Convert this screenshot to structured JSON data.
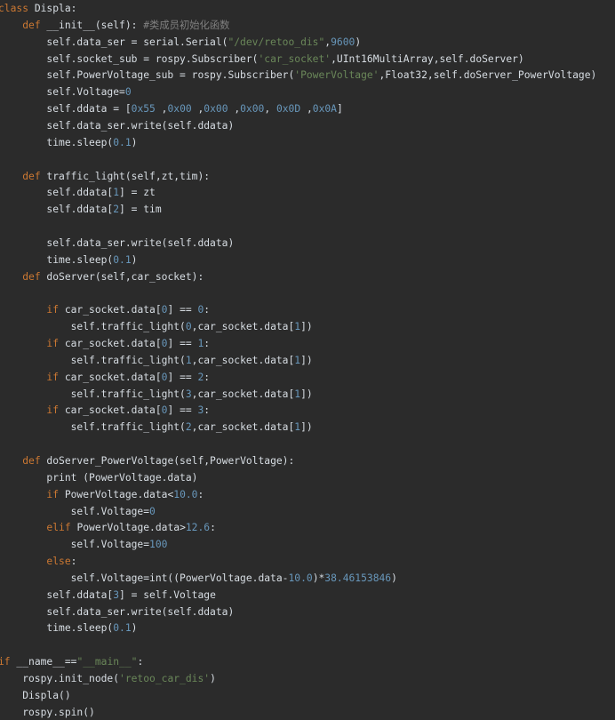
{
  "editor": {
    "colors": {
      "background": "#2b2b2b",
      "text": "#d7dde3",
      "keyword": "#cc7832",
      "number": "#6897bb",
      "string": "#6a8759",
      "comment": "#808080"
    },
    "lines": [
      {
        "tokens": [
          {
            "t": "class",
            "c": "kw"
          },
          {
            "t": " Displa:",
            "c": "txt"
          }
        ]
      },
      {
        "tokens": [
          {
            "t": "    ",
            "c": "txt"
          },
          {
            "t": "def",
            "c": "kw"
          },
          {
            "t": " __init__(self): ",
            "c": "txt"
          },
          {
            "t": "#类成员初始化函数",
            "c": "cmt"
          }
        ]
      },
      {
        "tokens": [
          {
            "t": "        self.data_ser = serial.Serial(",
            "c": "txt"
          },
          {
            "t": "\"/dev/retoo_dis\"",
            "c": "str"
          },
          {
            "t": ",",
            "c": "txt"
          },
          {
            "t": "9600",
            "c": "num"
          },
          {
            "t": ")",
            "c": "txt"
          }
        ]
      },
      {
        "tokens": [
          {
            "t": "        self.socket_sub = rospy.Subscriber(",
            "c": "txt"
          },
          {
            "t": "'car_socket'",
            "c": "str"
          },
          {
            "t": ",UInt16MultiArray,self.doServer)",
            "c": "txt"
          }
        ]
      },
      {
        "tokens": [
          {
            "t": "        self.PowerVoltage_sub = rospy.Subscriber(",
            "c": "txt"
          },
          {
            "t": "'PowerVoltage'",
            "c": "str"
          },
          {
            "t": ",Float32,self.doServer_PowerVoltage)",
            "c": "txt"
          }
        ]
      },
      {
        "tokens": [
          {
            "t": "        self.Voltage=",
            "c": "txt"
          },
          {
            "t": "0",
            "c": "num"
          }
        ]
      },
      {
        "tokens": [
          {
            "t": "        self.ddata = [",
            "c": "txt"
          },
          {
            "t": "0x55",
            "c": "num"
          },
          {
            "t": " ,",
            "c": "txt"
          },
          {
            "t": "0x00",
            "c": "num"
          },
          {
            "t": " ,",
            "c": "txt"
          },
          {
            "t": "0x00",
            "c": "num"
          },
          {
            "t": " ,",
            "c": "txt"
          },
          {
            "t": "0x00",
            "c": "num"
          },
          {
            "t": ", ",
            "c": "txt"
          },
          {
            "t": "0x0D",
            "c": "num"
          },
          {
            "t": " ,",
            "c": "txt"
          },
          {
            "t": "0x0A",
            "c": "num"
          },
          {
            "t": "]",
            "c": "txt"
          }
        ]
      },
      {
        "tokens": [
          {
            "t": "        self.data_ser.write(self.ddata)",
            "c": "txt"
          }
        ]
      },
      {
        "tokens": [
          {
            "t": "        time.sleep(",
            "c": "txt"
          },
          {
            "t": "0.1",
            "c": "num"
          },
          {
            "t": ")",
            "c": "txt"
          }
        ]
      },
      {
        "tokens": []
      },
      {
        "tokens": [
          {
            "t": "    ",
            "c": "txt"
          },
          {
            "t": "def",
            "c": "kw"
          },
          {
            "t": " traffic_light(self,zt,tim):",
            "c": "txt"
          }
        ]
      },
      {
        "tokens": [
          {
            "t": "        self.ddata[",
            "c": "txt"
          },
          {
            "t": "1",
            "c": "num"
          },
          {
            "t": "] = zt",
            "c": "txt"
          }
        ]
      },
      {
        "tokens": [
          {
            "t": "        self.ddata[",
            "c": "txt"
          },
          {
            "t": "2",
            "c": "num"
          },
          {
            "t": "] = tim",
            "c": "txt"
          }
        ]
      },
      {
        "tokens": []
      },
      {
        "tokens": [
          {
            "t": "        self.data_ser.write(self.ddata)",
            "c": "txt"
          }
        ]
      },
      {
        "tokens": [
          {
            "t": "        time.sleep(",
            "c": "txt"
          },
          {
            "t": "0.1",
            "c": "num"
          },
          {
            "t": ")",
            "c": "txt"
          }
        ]
      },
      {
        "tokens": [
          {
            "t": "    ",
            "c": "txt"
          },
          {
            "t": "def",
            "c": "kw"
          },
          {
            "t": " doServer(self,car_socket):",
            "c": "txt"
          }
        ]
      },
      {
        "tokens": []
      },
      {
        "tokens": [
          {
            "t": "        ",
            "c": "txt"
          },
          {
            "t": "if",
            "c": "kw"
          },
          {
            "t": " car_socket.data[",
            "c": "txt"
          },
          {
            "t": "0",
            "c": "num"
          },
          {
            "t": "] == ",
            "c": "txt"
          },
          {
            "t": "0",
            "c": "num"
          },
          {
            "t": ":",
            "c": "txt"
          }
        ]
      },
      {
        "tokens": [
          {
            "t": "            self.traffic_light(",
            "c": "txt"
          },
          {
            "t": "0",
            "c": "num"
          },
          {
            "t": ",car_socket.data[",
            "c": "txt"
          },
          {
            "t": "1",
            "c": "num"
          },
          {
            "t": "])",
            "c": "txt"
          }
        ]
      },
      {
        "tokens": [
          {
            "t": "        ",
            "c": "txt"
          },
          {
            "t": "if",
            "c": "kw"
          },
          {
            "t": " car_socket.data[",
            "c": "txt"
          },
          {
            "t": "0",
            "c": "num"
          },
          {
            "t": "] == ",
            "c": "txt"
          },
          {
            "t": "1",
            "c": "num"
          },
          {
            "t": ":",
            "c": "txt"
          }
        ]
      },
      {
        "tokens": [
          {
            "t": "            self.traffic_light(",
            "c": "txt"
          },
          {
            "t": "1",
            "c": "num"
          },
          {
            "t": ",car_socket.data[",
            "c": "txt"
          },
          {
            "t": "1",
            "c": "num"
          },
          {
            "t": "])",
            "c": "txt"
          }
        ]
      },
      {
        "tokens": [
          {
            "t": "        ",
            "c": "txt"
          },
          {
            "t": "if",
            "c": "kw"
          },
          {
            "t": " car_socket.data[",
            "c": "txt"
          },
          {
            "t": "0",
            "c": "num"
          },
          {
            "t": "] == ",
            "c": "txt"
          },
          {
            "t": "2",
            "c": "num"
          },
          {
            "t": ":",
            "c": "txt"
          }
        ]
      },
      {
        "tokens": [
          {
            "t": "            self.traffic_light(",
            "c": "txt"
          },
          {
            "t": "3",
            "c": "num"
          },
          {
            "t": ",car_socket.data[",
            "c": "txt"
          },
          {
            "t": "1",
            "c": "num"
          },
          {
            "t": "])",
            "c": "txt"
          }
        ]
      },
      {
        "tokens": [
          {
            "t": "        ",
            "c": "txt"
          },
          {
            "t": "if",
            "c": "kw"
          },
          {
            "t": " car_socket.data[",
            "c": "txt"
          },
          {
            "t": "0",
            "c": "num"
          },
          {
            "t": "] == ",
            "c": "txt"
          },
          {
            "t": "3",
            "c": "num"
          },
          {
            "t": ":",
            "c": "txt"
          }
        ]
      },
      {
        "tokens": [
          {
            "t": "            self.traffic_light(",
            "c": "txt"
          },
          {
            "t": "2",
            "c": "num"
          },
          {
            "t": ",car_socket.data[",
            "c": "txt"
          },
          {
            "t": "1",
            "c": "num"
          },
          {
            "t": "])",
            "c": "txt"
          }
        ]
      },
      {
        "tokens": []
      },
      {
        "tokens": [
          {
            "t": "    ",
            "c": "txt"
          },
          {
            "t": "def",
            "c": "kw"
          },
          {
            "t": " doServer_PowerVoltage(self,PowerVoltage):",
            "c": "txt"
          }
        ]
      },
      {
        "tokens": [
          {
            "t": "        print (PowerVoltage.data)",
            "c": "txt"
          }
        ]
      },
      {
        "tokens": [
          {
            "t": "        ",
            "c": "txt"
          },
          {
            "t": "if",
            "c": "kw"
          },
          {
            "t": " PowerVoltage.data<",
            "c": "txt"
          },
          {
            "t": "10.0",
            "c": "num"
          },
          {
            "t": ":",
            "c": "txt"
          }
        ]
      },
      {
        "tokens": [
          {
            "t": "            self.Voltage=",
            "c": "txt"
          },
          {
            "t": "0",
            "c": "num"
          }
        ]
      },
      {
        "tokens": [
          {
            "t": "        ",
            "c": "txt"
          },
          {
            "t": "elif",
            "c": "kw"
          },
          {
            "t": " PowerVoltage.data>",
            "c": "txt"
          },
          {
            "t": "12.6",
            "c": "num"
          },
          {
            "t": ":",
            "c": "txt"
          }
        ]
      },
      {
        "tokens": [
          {
            "t": "            self.Voltage=",
            "c": "txt"
          },
          {
            "t": "100",
            "c": "num"
          }
        ]
      },
      {
        "tokens": [
          {
            "t": "        ",
            "c": "txt"
          },
          {
            "t": "else",
            "c": "kw"
          },
          {
            "t": ":",
            "c": "txt"
          }
        ]
      },
      {
        "tokens": [
          {
            "t": "            self.Voltage=int((PowerVoltage.data-",
            "c": "txt"
          },
          {
            "t": "10.0",
            "c": "num"
          },
          {
            "t": ")*",
            "c": "txt"
          },
          {
            "t": "38.46153846",
            "c": "num"
          },
          {
            "t": ")",
            "c": "txt"
          }
        ]
      },
      {
        "tokens": [
          {
            "t": "        self.ddata[",
            "c": "txt"
          },
          {
            "t": "3",
            "c": "num"
          },
          {
            "t": "] = self.Voltage",
            "c": "txt"
          }
        ]
      },
      {
        "tokens": [
          {
            "t": "        self.data_ser.write(self.ddata)",
            "c": "txt"
          }
        ]
      },
      {
        "tokens": [
          {
            "t": "        time.sleep(",
            "c": "txt"
          },
          {
            "t": "0.1",
            "c": "num"
          },
          {
            "t": ")",
            "c": "txt"
          }
        ]
      },
      {
        "tokens": []
      },
      {
        "tokens": [
          {
            "t": "if",
            "c": "kw"
          },
          {
            "t": " __name__==",
            "c": "txt"
          },
          {
            "t": "\"__main__\"",
            "c": "str"
          },
          {
            "t": ":",
            "c": "txt"
          }
        ]
      },
      {
        "tokens": [
          {
            "t": "    rospy.init_node(",
            "c": "txt"
          },
          {
            "t": "'retoo_car_dis'",
            "c": "str"
          },
          {
            "t": ")",
            "c": "txt"
          }
        ]
      },
      {
        "tokens": [
          {
            "t": "    Displa()",
            "c": "txt"
          }
        ]
      },
      {
        "tokens": [
          {
            "t": "    rospy.spin()",
            "c": "txt"
          }
        ]
      }
    ]
  }
}
